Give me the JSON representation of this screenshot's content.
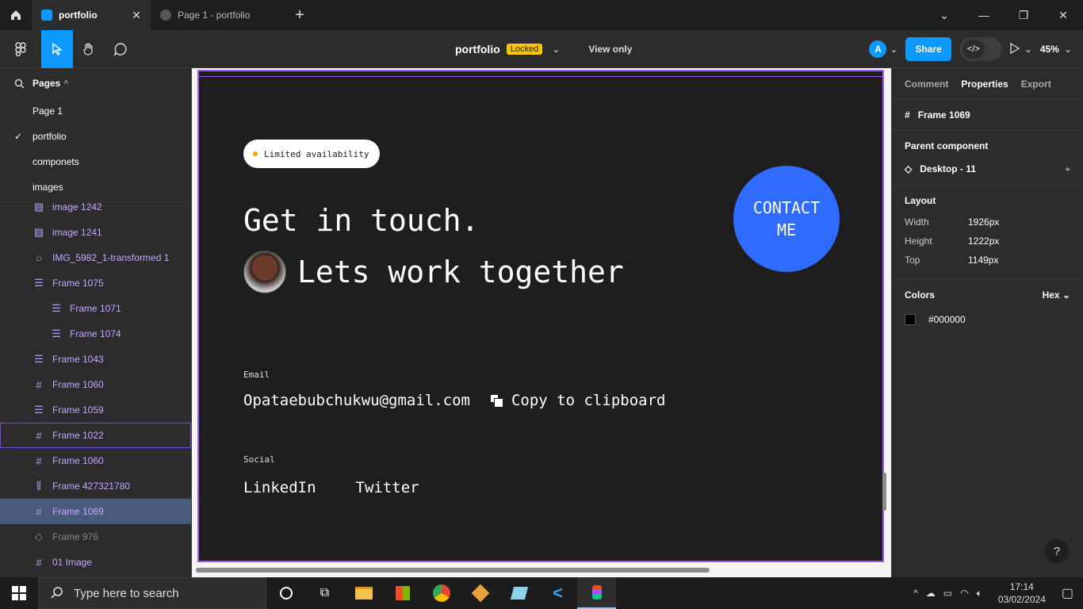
{
  "tabs": [
    {
      "label": "portfolio",
      "active": true
    },
    {
      "label": "Page 1 - portfolio",
      "active": false
    }
  ],
  "toolbar": {
    "doc_name": "portfolio",
    "locked_badge": "Locked",
    "view_only": "View only",
    "avatar_letter": "A",
    "share_label": "Share",
    "zoom": "45%"
  },
  "pages": {
    "header": "Pages",
    "items": [
      {
        "label": "Page 1"
      },
      {
        "label": "portfolio",
        "current": true
      },
      {
        "label": "componets"
      },
      {
        "label": "images"
      }
    ]
  },
  "layers": [
    {
      "label": "image 1242",
      "icon": "image-icon"
    },
    {
      "label": "image 1241",
      "icon": "image-icon"
    },
    {
      "label": "IMG_5982_1-transformed 1",
      "icon": "ellipse-icon"
    },
    {
      "label": "Frame 1075",
      "icon": "autolayout-vertical-icon"
    },
    {
      "label": "Frame 1071",
      "icon": "autolayout-vertical-icon",
      "indent": true
    },
    {
      "label": "Frame 1074",
      "icon": "autolayout-vertical-icon",
      "indent": true
    },
    {
      "label": "Frame 1043",
      "icon": "autolayout-vertical-icon"
    },
    {
      "label": "Frame 1060",
      "icon": "frame-icon"
    },
    {
      "label": "Frame 1059",
      "icon": "autolayout-vertical-icon"
    },
    {
      "label": "Frame 1022",
      "icon": "frame-icon",
      "hovered": true
    },
    {
      "label": "Frame 1060",
      "icon": "frame-icon"
    },
    {
      "label": "Frame 427321780",
      "icon": "autolayout-horizontal-icon"
    },
    {
      "label": "Frame 1069",
      "icon": "frame-icon",
      "selected": true
    },
    {
      "label": "Frame 976",
      "icon": "instance-icon",
      "dim": true
    },
    {
      "label": "01 Image",
      "icon": "frame-icon"
    }
  ],
  "canvas": {
    "availability": "Limited availability",
    "heading1": "Get in touch.",
    "heading2": "Lets work together",
    "contact_line1": "CONTACT",
    "contact_line2": "ME",
    "email_label": "Email",
    "email": "Opataebubchukwu@gmail.com",
    "copy_label": "Copy to clipboard",
    "social_label": "Social",
    "social_links": [
      "LinkedIn",
      "Twitter"
    ]
  },
  "properties": {
    "tabs": [
      "Comment",
      "Properties",
      "Export"
    ],
    "frame_name": "Frame 1069",
    "parent_header": "Parent component",
    "parent_name": "Desktop - 11",
    "layout_header": "Layout",
    "layout": [
      {
        "k": "Width",
        "v": "1926px"
      },
      {
        "k": "Height",
        "v": "1222px"
      },
      {
        "k": "Top",
        "v": "1149px"
      }
    ],
    "colors_header": "Colors",
    "color_format": "Hex",
    "color_value": "#000000"
  },
  "taskbar": {
    "search_placeholder": "Type here to search",
    "time": "17:14",
    "date": "03/02/2024"
  },
  "colors": {
    "accent": "#0d99ff",
    "layer_purple": "#c6a7ff",
    "contact_blue": "#2f6bff",
    "locked_yellow": "#ffc700"
  }
}
